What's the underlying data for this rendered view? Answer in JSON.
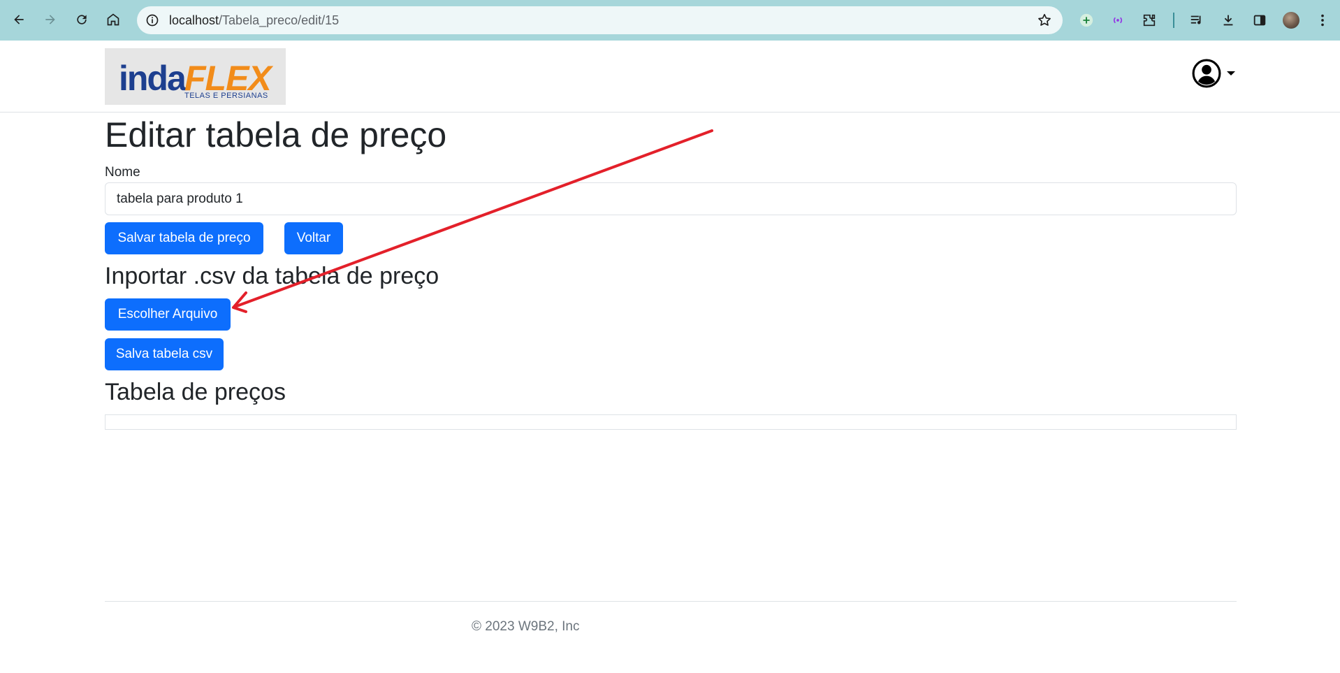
{
  "browser": {
    "url_host": "localhost",
    "url_path": "/Tabela_preco/edit/15",
    "accent_color": "#a6d6da"
  },
  "navbar": {
    "logo": {
      "word1": "inda",
      "word2": "FLEX",
      "tagline": "TELAS E PERSIANAS"
    },
    "user_icon": "user-circle-icon"
  },
  "page": {
    "title": "Editar tabela de preço",
    "name_label": "Nome",
    "name_value": "tabela para produto 1",
    "save_button": "Salvar tabela de preço",
    "back_button": "Voltar",
    "import_title": "Inportar .csv da tabela de preço",
    "choose_file_button": "Escolher Arquivo",
    "save_csv_button": "Salva tabela csv",
    "table_title": "Tabela de preços"
  },
  "footer": {
    "copyright": "© 2023 W9B2, Inc"
  },
  "colors": {
    "primary": "#0d6efd",
    "annotation_arrow": "#e3202a"
  }
}
